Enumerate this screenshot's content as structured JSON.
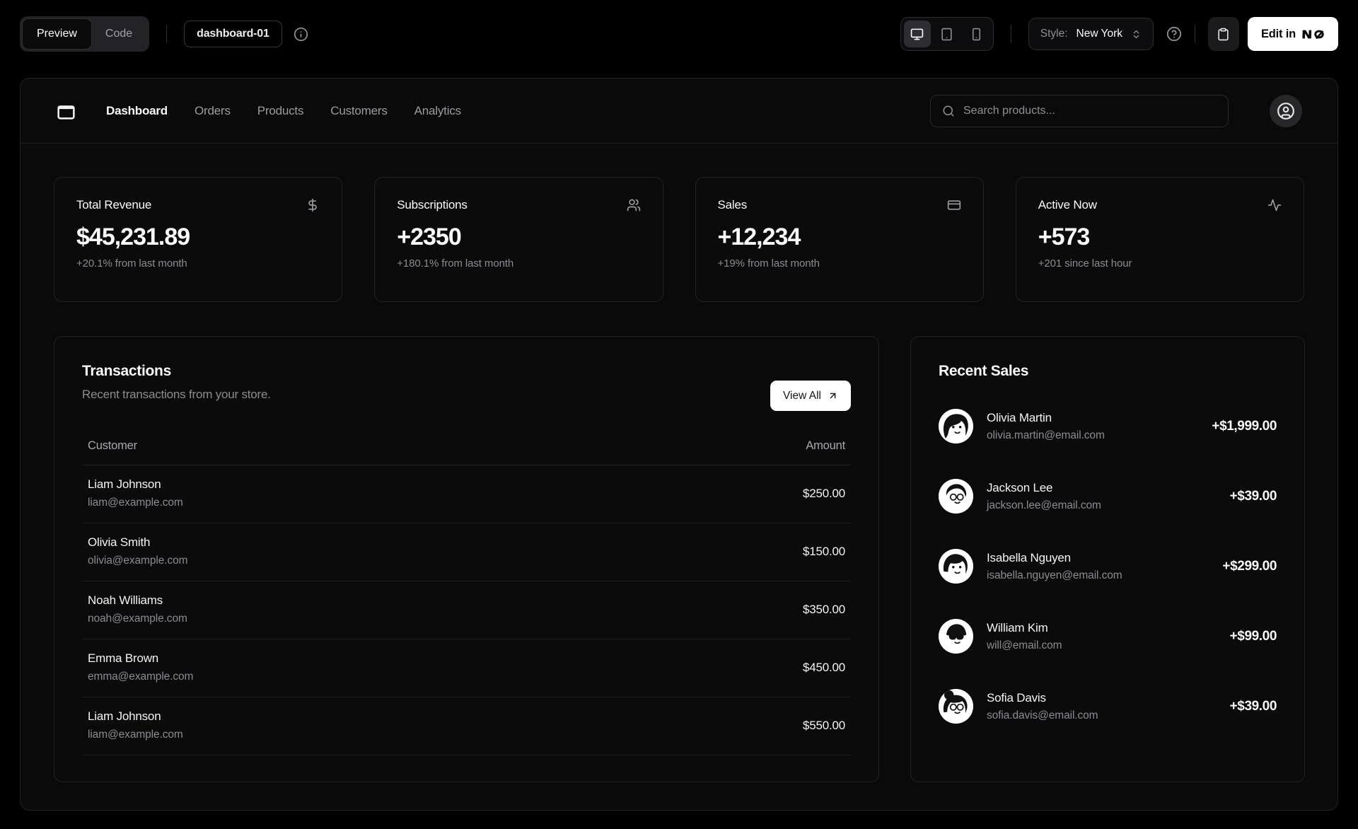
{
  "toolbar": {
    "view_tabs": [
      {
        "label": "Preview",
        "active": true
      },
      {
        "label": "Code",
        "active": false
      }
    ],
    "block_badge": "dashboard-01",
    "style_label": "Style:",
    "style_value": "New York",
    "edit_label": "Edit in",
    "edit_brand": "v0",
    "device_toggles": [
      "desktop",
      "tablet",
      "mobile"
    ],
    "active_device": "desktop"
  },
  "nav": {
    "items": [
      {
        "label": "Dashboard",
        "active": true
      },
      {
        "label": "Orders",
        "active": false
      },
      {
        "label": "Products",
        "active": false
      },
      {
        "label": "Customers",
        "active": false
      },
      {
        "label": "Analytics",
        "active": false
      }
    ],
    "search_placeholder": "Search products..."
  },
  "stats": [
    {
      "title": "Total Revenue",
      "icon": "dollar-icon",
      "value": "$45,231.89",
      "change": "+20.1% from last month"
    },
    {
      "title": "Subscriptions",
      "icon": "users-icon",
      "value": "+2350",
      "change": "+180.1% from last month"
    },
    {
      "title": "Sales",
      "icon": "credit-card-icon",
      "value": "+12,234",
      "change": "+19% from last month"
    },
    {
      "title": "Active Now",
      "icon": "activity-icon",
      "value": "+573",
      "change": "+201 since last hour"
    }
  ],
  "transactions": {
    "title": "Transactions",
    "subtitle": "Recent transactions from your store.",
    "view_all_label": "View All",
    "columns": [
      "Customer",
      "Amount"
    ],
    "rows": [
      {
        "name": "Liam Johnson",
        "email": "liam@example.com",
        "amount": "$250.00"
      },
      {
        "name": "Olivia Smith",
        "email": "olivia@example.com",
        "amount": "$150.00"
      },
      {
        "name": "Noah Williams",
        "email": "noah@example.com",
        "amount": "$350.00"
      },
      {
        "name": "Emma Brown",
        "email": "emma@example.com",
        "amount": "$450.00"
      },
      {
        "name": "Liam Johnson",
        "email": "liam@example.com",
        "amount": "$550.00"
      }
    ]
  },
  "recent_sales": {
    "title": "Recent Sales",
    "rows": [
      {
        "name": "Olivia Martin",
        "email": "olivia.martin@email.com",
        "amount": "+$1,999.00"
      },
      {
        "name": "Jackson Lee",
        "email": "jackson.lee@email.com",
        "amount": "+$39.00"
      },
      {
        "name": "Isabella Nguyen",
        "email": "isabella.nguyen@email.com",
        "amount": "+$299.00"
      },
      {
        "name": "William Kim",
        "email": "will@email.com",
        "amount": "+$99.00"
      },
      {
        "name": "Sofia Davis",
        "email": "sofia.davis@email.com",
        "amount": "+$39.00"
      }
    ]
  },
  "colors": {
    "page_background": "#000000",
    "panel_background": "#0a0a0a",
    "card_border": "#232327",
    "accent_button": "#ffffff",
    "muted_text": "#8b8b93"
  }
}
